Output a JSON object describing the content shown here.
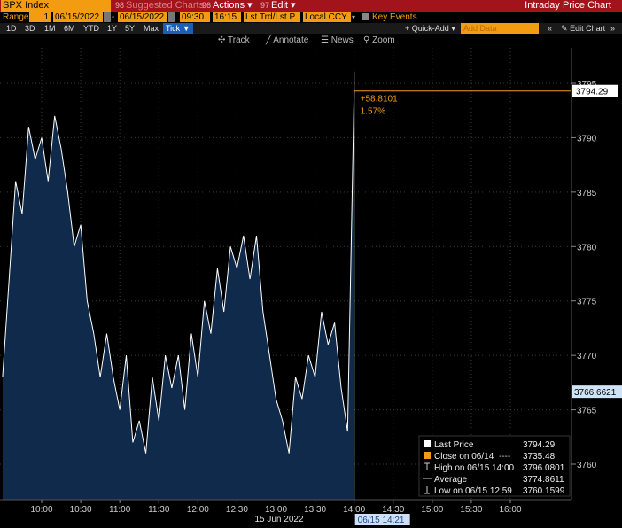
{
  "titlebar": {
    "security": "SPX Index",
    "suggested": "Suggested Charts",
    "suggested_num": "98",
    "actions": "Actions",
    "actions_num": "96",
    "edit": "Edit",
    "edit_num": "97",
    "title": "Intraday Price Chart"
  },
  "controls": {
    "range_label": "Range",
    "range_value": "1",
    "start_date": "06/15/2022",
    "end_date": "06/15/2022",
    "start_time": "09:30",
    "end_time": "16:15",
    "field": "Lst Trd/Lst P",
    "currency": "Local CCY",
    "key_events": "Key Events"
  },
  "periods": [
    "1D",
    "3D",
    "1M",
    "6M",
    "YTD",
    "1Y",
    "5Y",
    "Max"
  ],
  "tick_button": "Tick",
  "quick_add": "Quick-Add",
  "add_data_placeholder": "Add Data",
  "edit_chart": "Edit Chart",
  "tools": {
    "track": "Track",
    "annotate": "Annotate",
    "news": "News",
    "zoom": "Zoom"
  },
  "colors": {
    "accent": "#f39c12",
    "titlebar": "#a3131b",
    "area_fill": "#0f2a4a",
    "line": "#ffffff",
    "last_price_tag": "#ffffff",
    "selected_time_tag": "#cfe0f5"
  },
  "chart_data": {
    "type": "area",
    "series": [
      {
        "name": "Last Price",
        "x": [
          "09:30",
          "09:35",
          "09:40",
          "09:45",
          "09:50",
          "09:55",
          "10:00",
          "10:05",
          "10:10",
          "10:15",
          "10:20",
          "10:25",
          "10:30",
          "10:35",
          "10:40",
          "10:45",
          "10:50",
          "10:55",
          "11:00",
          "11:05",
          "11:10",
          "11:15",
          "11:20",
          "11:25",
          "11:30",
          "11:35",
          "11:40",
          "11:45",
          "11:50",
          "11:55",
          "12:00",
          "12:05",
          "12:10",
          "12:15",
          "12:20",
          "12:25",
          "12:30",
          "12:35",
          "12:40",
          "12:45",
          "12:50",
          "12:55",
          "13:00",
          "13:05",
          "13:10",
          "13:15",
          "13:20",
          "13:25",
          "13:30",
          "13:35",
          "13:40",
          "13:45",
          "13:50",
          "13:55",
          "14:00"
        ],
        "values": [
          3768.0,
          3777.0,
          3786.0,
          3783.0,
          3791.0,
          3788.0,
          3790.0,
          3786.0,
          3792.0,
          3789.0,
          3785.0,
          3780.0,
          3782.0,
          3775.0,
          3772.0,
          3768.0,
          3772.0,
          3768.0,
          3765.0,
          3770.0,
          3762.0,
          3764.0,
          3761.0,
          3768.0,
          3764.0,
          3770.0,
          3767.0,
          3770.0,
          3765.0,
          3772.0,
          3768.0,
          3775.0,
          3772.0,
          3778.0,
          3774.0,
          3780.0,
          3778.0,
          3781.0,
          3777.0,
          3781.0,
          3774.0,
          3770.0,
          3766.0,
          3764.0,
          3761.0,
          3768.0,
          3766.0,
          3770.0,
          3768.0,
          3774.0,
          3771.0,
          3773.0,
          3767.0,
          3763.0,
          3794.29
        ]
      }
    ],
    "xlabel": "15 Jun 2022",
    "x_ticks": [
      "10:00",
      "10:30",
      "11:00",
      "11:30",
      "12:00",
      "12:30",
      "13:00",
      "13:30",
      "14:00",
      "14:30",
      "15:00",
      "15:30",
      "16:00"
    ],
    "x_range": [
      "09:30",
      "16:15"
    ],
    "ylim": [
      3756,
      3798
    ],
    "y_ticks": [
      3760,
      3765,
      3770,
      3775,
      3780,
      3785,
      3790,
      3795
    ],
    "last_price_label": "3794.29",
    "change_label": "+58.8101",
    "change_pct_label": "1.57%",
    "average_label": "3766.6621",
    "selected_time_label": "06/15 14:21",
    "legend_position": "bottom-right",
    "legend": [
      {
        "label": "Last Price",
        "value": "3794.29",
        "marker": "white-square"
      },
      {
        "label": "Close on 06/14",
        "value": "3735.48",
        "marker": "orange-square",
        "dash": "----"
      },
      {
        "label": "High on 06/15 14:00",
        "value": "3796.0801",
        "marker": "high-tick"
      },
      {
        "label": "Average",
        "value": "3774.8611",
        "marker": "average-line"
      },
      {
        "label": "Low on 06/15 12:59",
        "value": "3760.1599",
        "marker": "low-tick"
      }
    ]
  }
}
